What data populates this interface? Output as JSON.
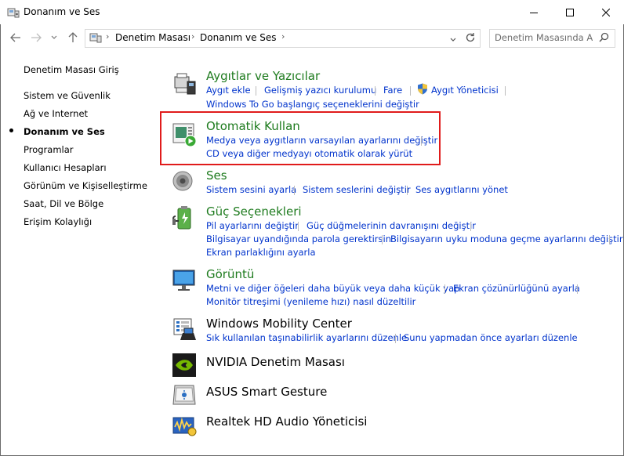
{
  "window": {
    "title": "Donanım ve Ses",
    "minimize_glyph": "—",
    "maximize_glyph": "☐",
    "close_glyph": "✕"
  },
  "address": {
    "crumbs": [
      "Denetim Masası",
      "Donanım ve Ses"
    ],
    "search_placeholder": "Denetim Masasında Ara"
  },
  "sidebar": {
    "items": [
      {
        "label": "Denetim Masası Giriş"
      },
      {
        "label": "Sistem ve Güvenlik"
      },
      {
        "label": "Ağ ve Internet"
      },
      {
        "label": "Donanım ve Ses",
        "current": true
      },
      {
        "label": "Programlar"
      },
      {
        "label": "Kullanıcı Hesapları"
      },
      {
        "label": "Görünüm ve Kişiselleştirme"
      },
      {
        "label": "Saat, Dil ve Bölge"
      },
      {
        "label": "Erişim Kolaylığı"
      }
    ]
  },
  "categories": {
    "devices": {
      "title": "Aygıtlar ve Yazıcılar",
      "links": [
        "Aygıt ekle",
        "Gelişmiş yazıcı kurulumu",
        "Fare",
        "Aygıt Yöneticisi",
        "Windows To Go başlangıç seçeneklerini değiştir"
      ]
    },
    "autoplay": {
      "title": "Otomatik Kullan",
      "links": [
        "Medya veya aygıtların varsayılan ayarlarını değiştir",
        "CD veya diğer medyayı otomatik olarak yürüt"
      ]
    },
    "sound": {
      "title": "Ses",
      "links": [
        "Sistem sesini ayarla",
        "Sistem seslerini değiştir",
        "Ses aygıtlarını yönet"
      ]
    },
    "power": {
      "title": "Güç Seçenekleri",
      "links": [
        "Pil ayarlarını değiştir",
        "Güç düğmelerinin davranışını değiştir",
        "Bilgisayar uyandığında parola gerektirsin",
        "Bilgisayarın uyku moduna geçme ayarlarını değiştir",
        "Ekran parlaklığını ayarla"
      ]
    },
    "display": {
      "title": "Görüntü",
      "links": [
        "Metni ve diğer öğeleri daha büyük veya daha küçük yap",
        "Ekran çözünürlüğünü ayarla",
        "Monitör titreşimi (yenileme hızı) nasıl düzeltilir"
      ]
    },
    "mobility": {
      "title": "Windows Mobility Center",
      "links": [
        "Sık kullanılan taşınabilirlik ayarlarını düzenle",
        "Sunu yapmadan önce ayarları düzenle"
      ]
    },
    "nvidia": {
      "title": "NVIDIA Denetim Masası"
    },
    "asus": {
      "title": "ASUS Smart Gesture"
    },
    "realtek": {
      "title": "Realtek HD Audio Yöneticisi"
    }
  },
  "colors": {
    "category_title": "#1e7b1e",
    "link": "#0033cc",
    "highlight": "#e01b1b"
  }
}
